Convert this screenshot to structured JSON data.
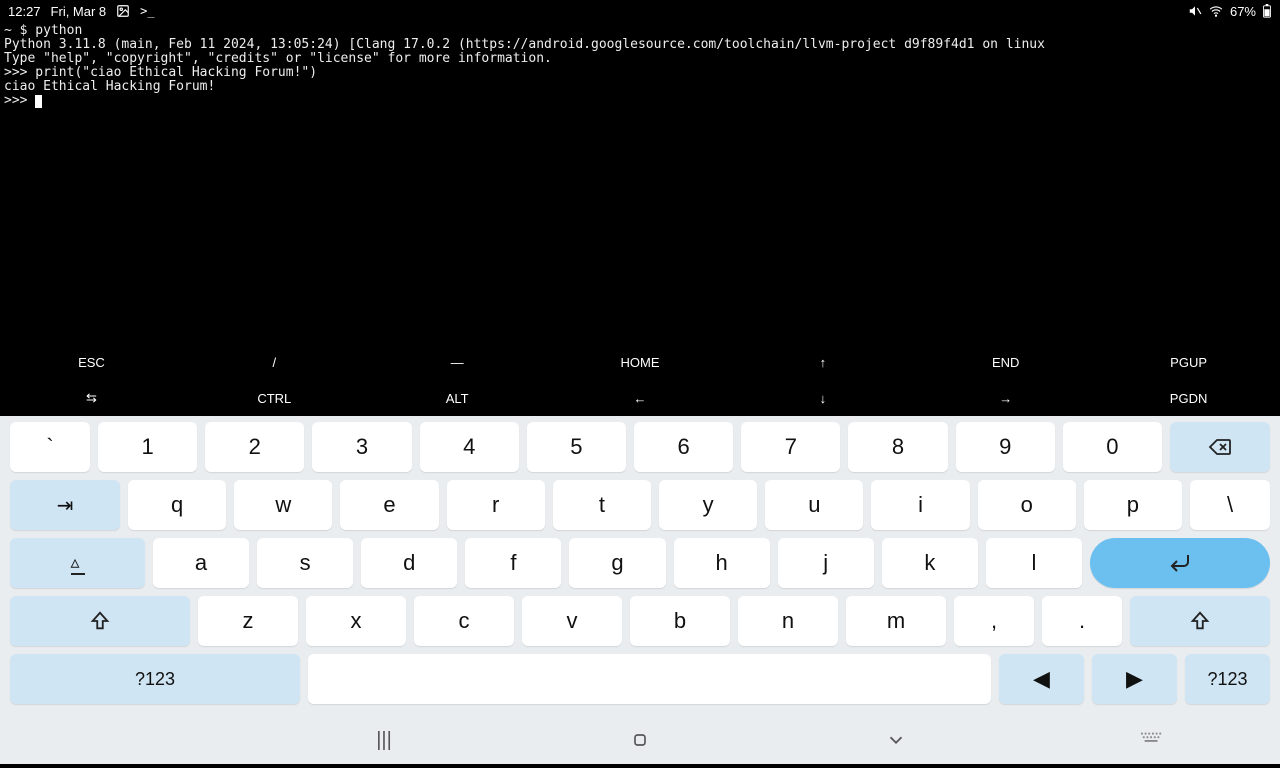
{
  "status": {
    "time": "12:27",
    "date": "Fri, Mar 8",
    "battery": "67%"
  },
  "terminal": {
    "line1": "~ $ python",
    "line2": "Python 3.11.8 (main, Feb 11 2024, 13:05:24) [Clang 17.0.2 (https://android.googlesource.com/toolchain/llvm-project d9f89f4d1 on linux",
    "line3": "Type \"help\", \"copyright\", \"credits\" or \"license\" for more information.",
    "line4": ">>> print(\"ciao Ethical Hacking Forum!\")",
    "line5": "ciao Ethical Hacking Forum!",
    "line6": ">>> "
  },
  "extra_rows": {
    "r1": [
      "ESC",
      "/",
      "―",
      "HOME",
      "↑",
      "END",
      "PGUP"
    ],
    "r2": [
      "⇆",
      "CTRL",
      "ALT",
      "←",
      "↓",
      "→",
      "PGDN"
    ]
  },
  "keys": {
    "row1": [
      "`",
      "1",
      "2",
      "3",
      "4",
      "5",
      "6",
      "7",
      "8",
      "9",
      "0"
    ],
    "row2": [
      "q",
      "w",
      "e",
      "r",
      "t",
      "y",
      "u",
      "i",
      "o",
      "p",
      "\\"
    ],
    "row3": [
      "a",
      "s",
      "d",
      "f",
      "g",
      "h",
      "j",
      "k",
      "l"
    ],
    "row4": [
      "z",
      "x",
      "c",
      "v",
      "b",
      "n",
      "m",
      ",",
      "."
    ],
    "sym": "?123",
    "sym2": "?123"
  }
}
